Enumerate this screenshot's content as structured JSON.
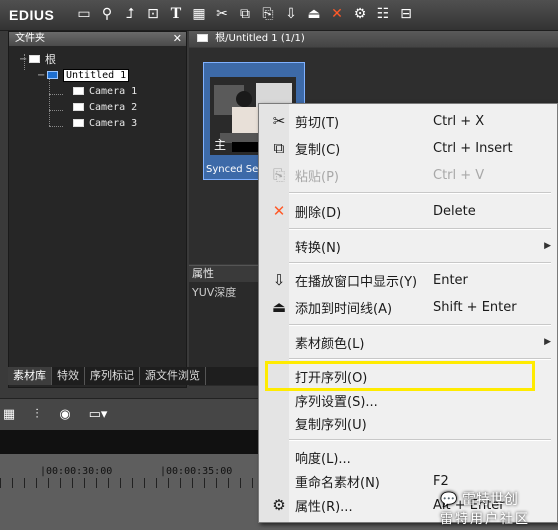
{
  "app": {
    "title": "EDIUS"
  },
  "toolbar": {
    "icons": [
      "folder-icon",
      "search-icon",
      "up-level-icon",
      "new-clip-icon",
      "title-icon",
      "color-bars-icon",
      "cut-icon",
      "copy-icon",
      "paste-icon",
      "show-in-player-icon",
      "add-to-timeline-icon",
      "delete-icon",
      "properties-icon",
      "view-icon",
      "bin-icon"
    ]
  },
  "folder_panel": {
    "title": "文件夹",
    "root": "根",
    "sequence": "Untitled 1",
    "cameras": [
      "Camera 1",
      "Camera 2",
      "Camera 3"
    ]
  },
  "bin": {
    "path": "根/Untitled 1 (1/1)",
    "clip_label": "Synced Seq",
    "thumb_caption": "主"
  },
  "properties": {
    "title": "属性",
    "row": "YUV深度"
  },
  "tabs": [
    "素材库",
    "特效",
    "序列标记",
    "源文件浏览"
  ],
  "timeline": {
    "timecodes": [
      "|00:00:30:00",
      "|00:00:35:00"
    ]
  },
  "context_menu": {
    "items": [
      {
        "label": "剪切(T)",
        "shortcut": "Ctrl + X",
        "icon": "scissors-icon",
        "disabled": false
      },
      {
        "label": "复制(C)",
        "shortcut": "Ctrl + Insert",
        "icon": "copy-icon",
        "disabled": false
      },
      {
        "label": "粘贴(P)",
        "shortcut": "Ctrl + V",
        "icon": "paste-icon",
        "disabled": true
      },
      {
        "label": "删除(D)",
        "shortcut": "Delete",
        "icon": "delete-icon",
        "disabled": false
      },
      {
        "label": "转换(N)",
        "shortcut": "",
        "icon": "",
        "submenu": true
      },
      {
        "label": "在播放窗口中显示(Y)",
        "shortcut": "Enter",
        "icon": "show-in-player-icon"
      },
      {
        "label": "添加到时间线(A)",
        "shortcut": "Shift + Enter",
        "icon": "add-to-timeline-icon"
      },
      {
        "label": "素材颜色(L)",
        "shortcut": "",
        "icon": "",
        "submenu": true
      },
      {
        "label": "打开序列(O)",
        "shortcut": "",
        "icon": "",
        "highlighted": true
      },
      {
        "label": "序列设置(S)...",
        "shortcut": "",
        "icon": ""
      },
      {
        "label": "复制序列(U)",
        "shortcut": "",
        "icon": ""
      },
      {
        "label": "响度(L)...",
        "shortcut": "",
        "icon": ""
      },
      {
        "label": "重命名素材(N)",
        "shortcut": "F2",
        "icon": ""
      },
      {
        "label": "属性(R)...",
        "shortcut": "Alt + Enter",
        "icon": "properties-icon"
      }
    ]
  },
  "watermark": {
    "line1": "雷特世创",
    "line2": "雷特用户社区"
  },
  "colors": {
    "highlight_box": "#ffeb00",
    "delete_icon": "#ff5a28",
    "clip_selected": "#3d6aa8"
  }
}
